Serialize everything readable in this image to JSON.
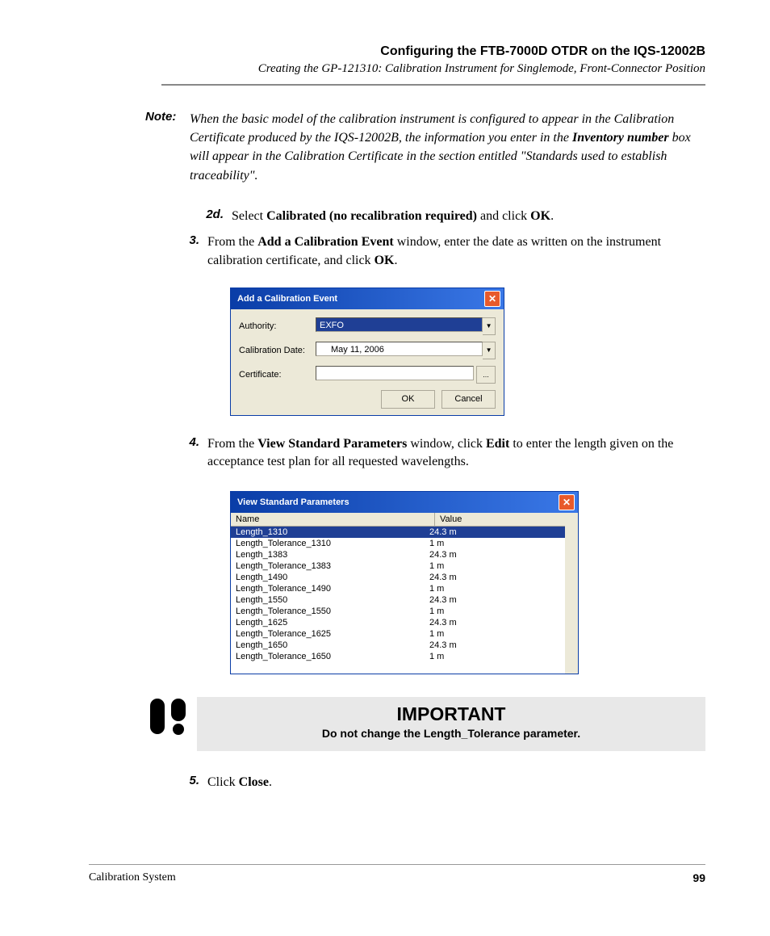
{
  "header": {
    "title": "Configuring the FTB-7000D OTDR on the IQS-12002B",
    "sub": "Creating the GP-121310: Calibration Instrument for Singlemode, Front-Connector Position"
  },
  "note": {
    "label": "Note:",
    "text_a": "When the basic model of the calibration instrument is configured to appear in the Calibration Certificate produced by the IQS-12002B, the information you enter in the ",
    "text_b": "Inventory number",
    "text_c": " box will appear in the Calibration Certificate in the section entitled \"Standards used to establish traceability\"."
  },
  "step_2d": {
    "num": "2d.",
    "a": "Select ",
    "b": "Calibrated (no recalibration required)",
    "c": " and click ",
    "d": "OK",
    "e": "."
  },
  "step_3": {
    "num": "3.",
    "a": "From the ",
    "b": "Add a Calibration Event",
    "c": " window, enter the date as written on the instrument calibration certificate, and click ",
    "d": "OK",
    "e": "."
  },
  "dialog1": {
    "title": "Add a Calibration Event",
    "authority_label": "Authority:",
    "authority_value": "EXFO",
    "caldate_label": "Calibration Date:",
    "caldate_value": "May     11, 2006",
    "cert_label": "Certificate:",
    "cert_value": "",
    "ok": "OK",
    "cancel": "Cancel"
  },
  "step_4": {
    "num": "4.",
    "a": "From the ",
    "b": "View Standard Parameters",
    "c": " window, click ",
    "d": "Edit",
    "e": " to enter the length given on the acceptance test plan for all requested wavelengths."
  },
  "dialog2": {
    "title": "View Standard Parameters",
    "hdr_name": "Name",
    "hdr_value": "Value",
    "rows": [
      {
        "n": "Length_1310",
        "v": "24.3 m"
      },
      {
        "n": "Length_Tolerance_1310",
        "v": "1 m"
      },
      {
        "n": "Length_1383",
        "v": "24.3 m"
      },
      {
        "n": "Length_Tolerance_1383",
        "v": "1 m"
      },
      {
        "n": "Length_1490",
        "v": "24.3 m"
      },
      {
        "n": "Length_Tolerance_1490",
        "v": "1 m"
      },
      {
        "n": "Length_1550",
        "v": "24.3 m"
      },
      {
        "n": "Length_Tolerance_1550",
        "v": "1 m"
      },
      {
        "n": "Length_1625",
        "v": "24.3 m"
      },
      {
        "n": "Length_Tolerance_1625",
        "v": "1 m"
      },
      {
        "n": "Length_1650",
        "v": "24.3 m"
      },
      {
        "n": "Length_Tolerance_1650",
        "v": "1 m"
      }
    ]
  },
  "important": {
    "title": "IMPORTANT",
    "text": "Do not change the Length_Tolerance parameter."
  },
  "step_5": {
    "num": "5.",
    "a": "Click ",
    "b": "Close",
    "c": "."
  },
  "footer": {
    "left": "Calibration System",
    "page": "99"
  }
}
